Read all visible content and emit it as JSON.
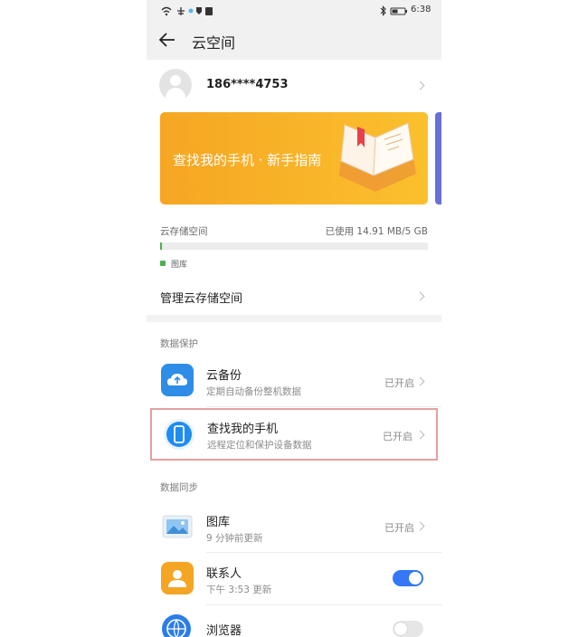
{
  "status_bar": {
    "time": "6:38"
  },
  "header": {
    "title": "云空间"
  },
  "account": {
    "phone": "186****4753"
  },
  "banner": {
    "text": "查找我的手机 · 新手指南",
    "book_text": "新手指南"
  },
  "storage": {
    "label": "云存储空间",
    "usage": "已使用 14.91 MB/5 GB",
    "used_fraction": 0.003,
    "legend_label": "图库",
    "legend_color": "#4caf50",
    "manage_label": "管理云存储空间"
  },
  "data_protection": {
    "section_label": "数据保护",
    "items": [
      {
        "title": "云备份",
        "subtitle": "定期自动备份整机数据",
        "status": "已开启",
        "icon": "cloud-backup-icon"
      },
      {
        "title": "查找我的手机",
        "subtitle": "远程定位和保护设备数据",
        "status": "已开启",
        "icon": "find-phone-icon"
      }
    ]
  },
  "data_sync": {
    "section_label": "数据同步",
    "items": [
      {
        "title": "图库",
        "subtitle": "9 分钟前更新",
        "status": "已开启",
        "icon": "gallery-icon"
      },
      {
        "title": "联系人",
        "subtitle": "下午 3:53 更新",
        "toggle_on": true,
        "icon": "contacts-icon"
      },
      {
        "title": "浏览器",
        "toggle_on": false,
        "icon": "browser-icon"
      }
    ]
  },
  "colors": {
    "accent": "#3478f6",
    "highlight_border": "#e4a0a0",
    "banner_start": "#f6a623",
    "banner_end": "#fbc531"
  }
}
